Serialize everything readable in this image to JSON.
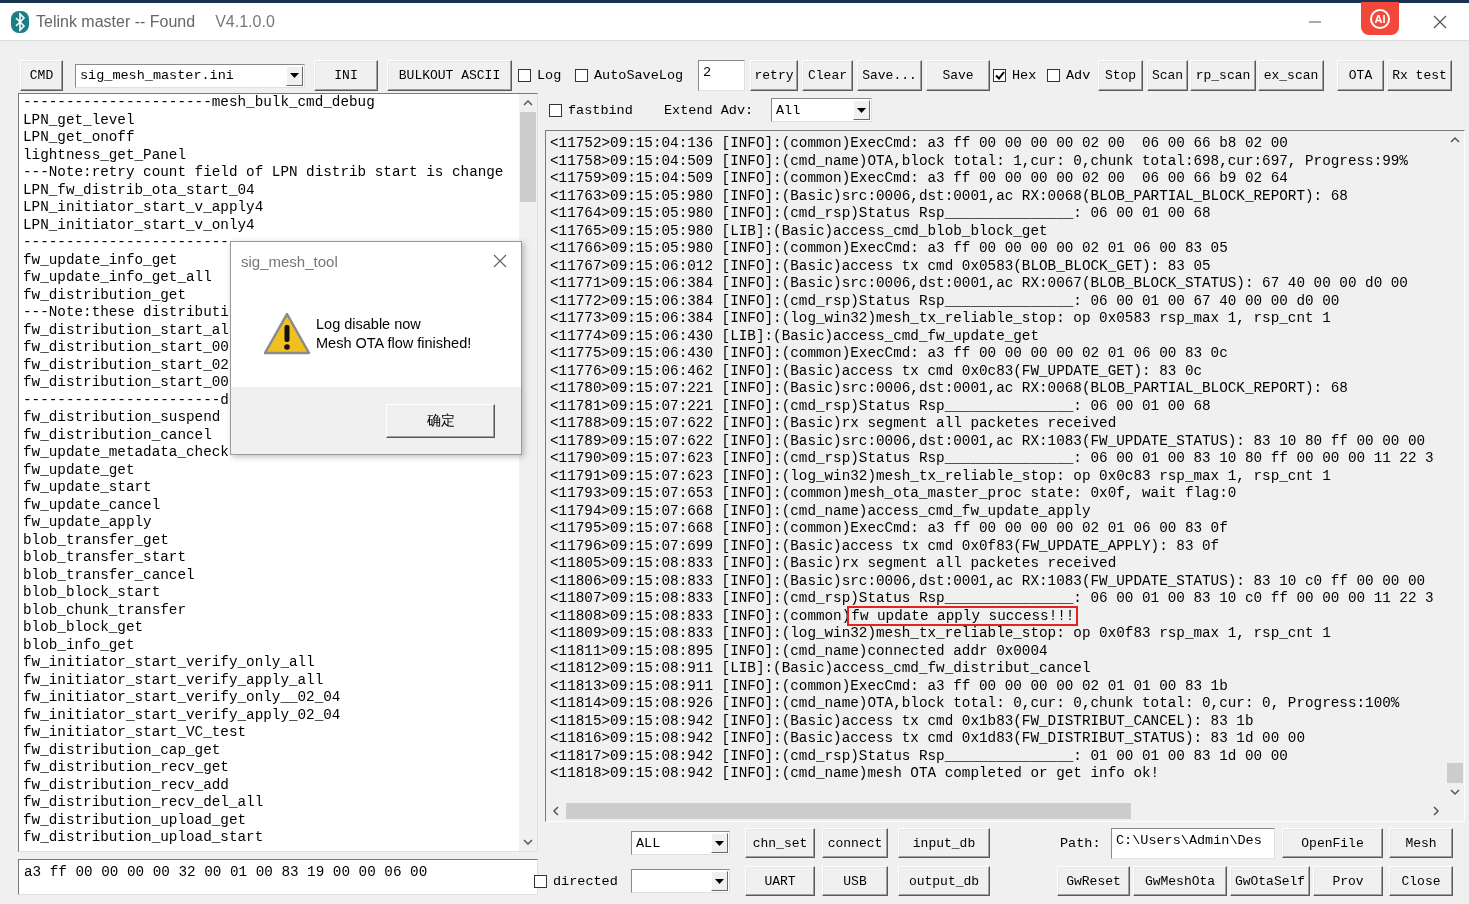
{
  "window": {
    "title": "Telink master -- Found",
    "version": "V4.1.0.0",
    "assistant_badge": "AI"
  },
  "toolbar": [
    {
      "kind": "button",
      "label": "CMD"
    },
    {
      "kind": "select",
      "value": "sig_mesh_master.ini"
    },
    {
      "kind": "button",
      "label": "INI"
    },
    {
      "kind": "button",
      "label": "BULKOUT ASCII"
    },
    {
      "kind": "checkbox",
      "label": "Log",
      "checked": false
    },
    {
      "kind": "checkbox",
      "label": "AutoSaveLog",
      "checked": false
    },
    {
      "kind": "input",
      "value": "2"
    },
    {
      "kind": "button",
      "label": "retry"
    },
    {
      "kind": "button",
      "label": "Clear"
    },
    {
      "kind": "button",
      "label": "Save..."
    },
    {
      "kind": "button",
      "label": "Save"
    },
    {
      "kind": "checkbox",
      "label": "Hex",
      "checked": true
    },
    {
      "kind": "checkbox",
      "label": "Adv",
      "checked": false
    },
    {
      "kind": "button",
      "label": "Stop"
    },
    {
      "kind": "button",
      "label": "Scan"
    },
    {
      "kind": "button",
      "label": "rp_scan"
    },
    {
      "kind": "button",
      "label": "ex_scan"
    },
    {
      "kind": "button",
      "label": "OTA"
    },
    {
      "kind": "button",
      "label": "Rx test"
    }
  ],
  "options": [
    {
      "kind": "checkbox",
      "label": "fastbind",
      "checked": false
    },
    {
      "kind": "label",
      "label": "Extend Adv:"
    },
    {
      "kind": "select",
      "value": "All"
    }
  ],
  "command_list": {
    "items": [
      "----------------------mesh_bulk_cmd_debug",
      "LPN_get_level",
      "LPN_get_onoff",
      "lightness_get_Panel",
      "---Note:retry count field of LPN distrib start is change",
      "LPN_fw_distrib_ota_start_04",
      "LPN_initiator_start_v_apply4",
      "LPN_initiator_start_v_only4",
      "------------------------",
      "fw_update_info_get",
      "fw_update_info_get_all",
      "fw_distribution_get",
      "---Note:these distributi",
      "fw_distribution_start_al",
      "fw_distribution_start_00",
      "fw_distribution_start_02",
      "fw_distribution_start_00",
      "-----------------------d",
      "fw_distribution_suspend",
      "fw_distribution_cancel",
      "fw_update_metadata_check",
      "fw_update_get",
      "fw_update_start",
      "fw_update_cancel",
      "fw_update_apply",
      "blob_transfer_get",
      "blob_transfer_start",
      "blob_transfer_cancel",
      "blob_block_start",
      "blob_chunk_transfer",
      "blob_block_get",
      "blob_info_get",
      "fw_initiator_start_verify_only_all",
      "fw_initiator_start_verify_apply_all",
      "fw_initiator_start_verify_only__02_04",
      "fw_initiator_start_verify_apply_02_04",
      "fw_initiator_start_VC_test",
      "fw_distribution_cap_get",
      "fw_distribution_recv_get",
      "fw_distribution_recv_add",
      "fw_distribution_recv_del_all",
      "fw_distribution_upload_get",
      "fw_distribution_upload_start"
    ]
  },
  "command_input": {
    "value": "a3 ff 00 00 00 00 32 00 01 00 83 19 00 00 06 00"
  },
  "log": {
    "lines": [
      {
        "text": "<11752>09:15:04:136 [INFO]:(common)ExecCmd: a3 ff 00 00 00 00 02 00  06 00 66 b8 02 00"
      },
      {
        "text": "<11758>09:15:04:509 [INFO]:(cmd_name)OTA,block total: 1,cur: 0,chunk total:698,cur:697, Progress:99%"
      },
      {
        "text": "<11759>09:15:04:509 [INFO]:(common)ExecCmd: a3 ff 00 00 00 00 02 00  06 00 66 b9 02 64"
      },
      {
        "text": "<11763>09:15:05:980 [INFO]:(Basic)src:0006,dst:0001,ac RX:0068(BLOB_PARTIAL_BLOCK_REPORT): 68"
      },
      {
        "text": "<11764>09:15:05:980 [INFO]:(cmd_rsp)Status Rsp_______________: 06 00 01 00 68"
      },
      {
        "text": "<11765>09:15:05:980 [LIB]:(Basic)access_cmd_blob_block_get"
      },
      {
        "text": "<11766>09:15:05:980 [INFO]:(common)ExecCmd: a3 ff 00 00 00 00 02 01 06 00 83 05"
      },
      {
        "text": "<11767>09:15:06:012 [INFO]:(Basic)access tx cmd 0x0583(BLOB_BLOCK_GET): 83 05"
      },
      {
        "text": "<11771>09:15:06:384 [INFO]:(Basic)src:0006,dst:0001,ac RX:0067(BLOB_BLOCK_STATUS): 67 40 00 00 d0 00"
      },
      {
        "text": "<11772>09:15:06:384 [INFO]:(cmd_rsp)Status Rsp_______________: 06 00 01 00 67 40 00 00 d0 00"
      },
      {
        "text": "<11773>09:15:06:384 [INFO]:(log_win32)mesh_tx_reliable_stop: op 0x0583 rsp_max 1, rsp_cnt 1"
      },
      {
        "text": "<11774>09:15:06:430 [LIB]:(Basic)access_cmd_fw_update_get"
      },
      {
        "text": "<11775>09:15:06:430 [INFO]:(common)ExecCmd: a3 ff 00 00 00 00 02 01 06 00 83 0c"
      },
      {
        "text": "<11776>09:15:06:462 [INFO]:(Basic)access tx cmd 0x0c83(FW_UPDATE_GET): 83 0c"
      },
      {
        "text": "<11780>09:15:07:221 [INFO]:(Basic)src:0006,dst:0001,ac RX:0068(BLOB_PARTIAL_BLOCK_REPORT): 68"
      },
      {
        "text": "<11781>09:15:07:221 [INFO]:(cmd_rsp)Status Rsp_______________: 06 00 01 00 68"
      },
      {
        "text": "<11788>09:15:07:622 [INFO]:(Basic)rx segment all packetes received"
      },
      {
        "text": "<11789>09:15:07:622 [INFO]:(Basic)src:0006,dst:0001,ac RX:1083(FW_UPDATE_STATUS): 83 10 80 ff 00 00 00"
      },
      {
        "text": "<11790>09:15:07:623 [INFO]:(cmd_rsp)Status Rsp_______________: 06 00 01 00 83 10 80 ff 00 00 00 11 22 3"
      },
      {
        "text": "<11791>09:15:07:623 [INFO]:(log_win32)mesh_tx_reliable_stop: op 0x0c83 rsp_max 1, rsp_cnt 1"
      },
      {
        "text": "<11793>09:15:07:653 [INFO]:(common)mesh_ota_master_proc state: 0x0f, wait flag:0"
      },
      {
        "text": "<11794>09:15:07:668 [INFO]:(cmd_name)access_cmd_fw_update_apply"
      },
      {
        "text": "<11795>09:15:07:668 [INFO]:(common)ExecCmd: a3 ff 00 00 00 00 02 01 06 00 83 0f"
      },
      {
        "text": "<11796>09:15:07:699 [INFO]:(Basic)access tx cmd 0x0f83(FW_UPDATE_APPLY): 83 0f"
      },
      {
        "text": "<11805>09:15:08:833 [INFO]:(Basic)rx segment all packetes received"
      },
      {
        "text": "<11806>09:15:08:833 [INFO]:(Basic)src:0006,dst:0001,ac RX:1083(FW_UPDATE_STATUS): 83 10 c0 ff 00 00 00"
      },
      {
        "text": "<11807>09:15:08:833 [INFO]:(cmd_rsp)Status Rsp_______________: 06 00 01 00 83 10 c0 ff 00 00 00 11 22 3"
      },
      {
        "text": "<11808>09:15:08:833 [INFO]:(common)",
        "highlight": "fw update apply success!!!"
      },
      {
        "text": "<11809>09:15:08:833 [INFO]:(log_win32)mesh_tx_reliable_stop: op 0x0f83 rsp_max 1, rsp_cnt 1"
      },
      {
        "text": "<11811>09:15:08:895 [INFO]:(cmd_name)connected addr 0x0004"
      },
      {
        "text": "<11812>09:15:08:911 [LIB]:(Basic)access_cmd_fw_distribut_cancel"
      },
      {
        "text": "<11813>09:15:08:911 [INFO]:(common)ExecCmd: a3 ff 00 00 00 00 02 01 01 00 83 1b"
      },
      {
        "text": "<11814>09:15:08:926 [INFO]:(cmd_name)OTA,block total: 0,cur: 0,chunk total: 0,cur: 0, Progress:100%"
      },
      {
        "text": "<11815>09:15:08:942 [INFO]:(Basic)access tx cmd 0x1b83(FW_DISTRIBUT_CANCEL): 83 1b"
      },
      {
        "text": "<11816>09:15:08:942 [INFO]:(Basic)access tx cmd 0x1d83(FW_DISTRIBUT_STATUS): 83 1d 00 00"
      },
      {
        "text": "<11817>09:15:08:942 [INFO]:(cmd_rsp)Status Rsp_______________: 01 00 01 00 83 1d 00 00"
      },
      {
        "text": "<11818>09:15:08:942 [INFO]:(cmd_name)mesh OTA completed or get info ok!"
      }
    ]
  },
  "bottom_controls": {
    "row_1": [
      {
        "kind": "select",
        "value": "ALL"
      },
      {
        "kind": "button",
        "label": "chn_set"
      },
      {
        "kind": "button",
        "label": "connect"
      },
      {
        "kind": "button",
        "label": "input_db"
      },
      {
        "kind": "label",
        "label": "Path:"
      },
      {
        "kind": "input",
        "value": "C:\\Users\\Admin\\Des"
      },
      {
        "kind": "button",
        "label": "OpenFile"
      },
      {
        "kind": "button",
        "label": "Mesh"
      }
    ],
    "row_2": [
      {
        "kind": "checkbox",
        "label": "directed",
        "checked": false
      },
      {
        "kind": "select"
      },
      {
        "kind": "button",
        "label": "UART"
      },
      {
        "kind": "button",
        "label": "USB"
      },
      {
        "kind": "button",
        "label": "output_db"
      },
      {
        "kind": "button",
        "label": "GwReset"
      },
      {
        "kind": "button",
        "label": "GwMeshOta"
      },
      {
        "kind": "button",
        "label": "GwOtaSelf"
      },
      {
        "kind": "button",
        "label": "Prov"
      },
      {
        "kind": "button",
        "label": "Close"
      }
    ]
  },
  "dialog": {
    "title": "sig_mesh_tool",
    "message": [
      "Log disable now",
      "Mesh OTA flow finished!"
    ],
    "button": "确定"
  }
}
